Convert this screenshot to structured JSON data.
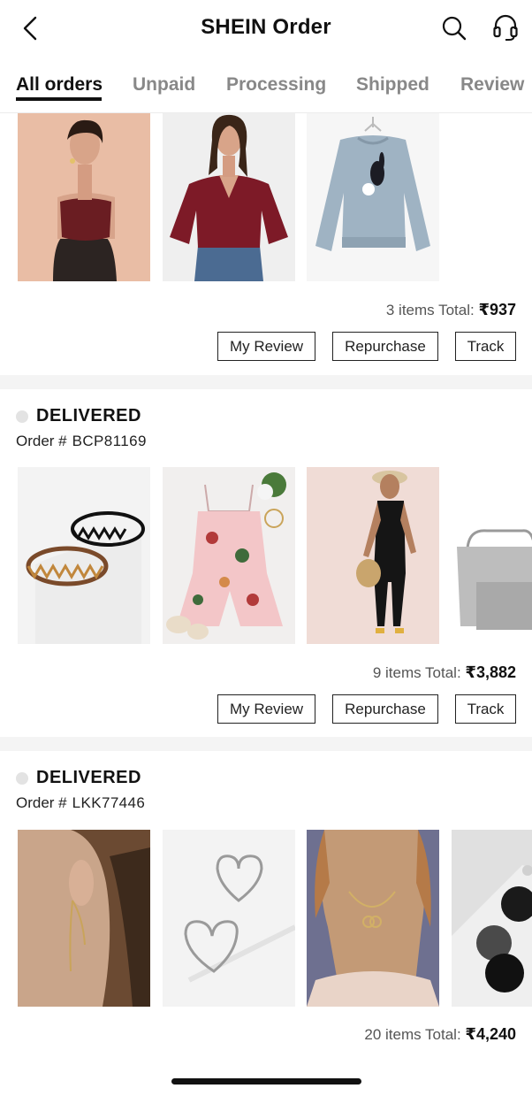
{
  "header": {
    "title": "SHEIN Order",
    "back_icon": "chevron-left-icon",
    "search_icon": "search-icon",
    "support_icon": "headset-icon"
  },
  "tabs": [
    {
      "label": "All orders",
      "active": true
    },
    {
      "label": "Unpaid",
      "active": false
    },
    {
      "label": "Processing",
      "active": false
    },
    {
      "label": "Shipped",
      "active": false
    },
    {
      "label": "Review",
      "active": false
    }
  ],
  "orders": [
    {
      "status": "",
      "order_label": "",
      "order_number": "",
      "items": [
        "red sparkle tube top",
        "burgundy flutter-sleeve blouse",
        "grey bunny sweatshirt"
      ],
      "items_total_label": "3 items Total:",
      "total": "₹937",
      "buttons": {
        "review": "My Review",
        "repurchase": "Repurchase",
        "track": "Track"
      }
    },
    {
      "status": "DELIVERED",
      "order_label": "Order #",
      "order_number": "BCP81169",
      "items": [
        "wavy headbands",
        "floral strappy romper",
        "black cami jumpsuit",
        "grey tote bag"
      ],
      "items_total_label": "9 items Total:",
      "total": "₹3,882",
      "buttons": {
        "review": "My Review",
        "repurchase": "Repurchase",
        "track": "Track"
      }
    },
    {
      "status": "DELIVERED",
      "order_label": "Order #",
      "order_number": "LKK77446",
      "items": [
        "threader earring",
        "heart hoop earrings",
        "interlocking ring necklace",
        "round disc earrings"
      ],
      "items_total_label": "20 items Total:",
      "total": "₹4,240"
    }
  ],
  "colors": {
    "accent": "#111111",
    "muted_tab": "#888888",
    "separator": "#f4f4f4",
    "status_dot": "#e3e3e3"
  }
}
